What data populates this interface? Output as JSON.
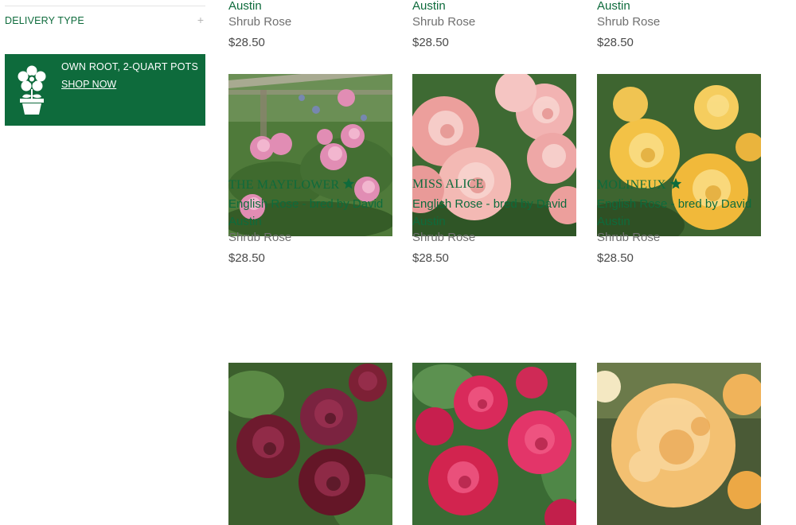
{
  "sidebar": {
    "filter_label": "DELIVERY TYPE",
    "filter_toggle": "+",
    "promo": {
      "title": "OWN ROOT, 2-QUART POTS",
      "link": "SHOP NOW",
      "icon": "potted-flower-icon"
    }
  },
  "colors": {
    "brand_green": "#0e6b3c",
    "text_gray": "#707070",
    "price_text": "#4a4a4a"
  },
  "top_row": [
    {
      "subtitle_tail": "Austin",
      "type": "Shrub Rose",
      "price": "$28.50"
    },
    {
      "subtitle_tail": "Austin",
      "type": "Shrub Rose",
      "price": "$28.50"
    },
    {
      "subtitle_tail": "Austin",
      "type": "Shrub Rose",
      "price": "$28.50"
    }
  ],
  "products": [
    {
      "name": "THE MAYFLOWER",
      "favorite": true,
      "subtitle": "English Rose - bred by David Austin",
      "type": "Shrub Rose",
      "price": "$28.50"
    },
    {
      "name": "MISS ALICE",
      "favorite": false,
      "subtitle": "English Rose - bred by David Austin",
      "type": "Shrub Rose",
      "price": "$28.50"
    },
    {
      "name": "MOLINEUX",
      "favorite": true,
      "subtitle": "English Rose - bred by David Austin",
      "type": "Shrub Rose",
      "price": "$28.50"
    }
  ]
}
